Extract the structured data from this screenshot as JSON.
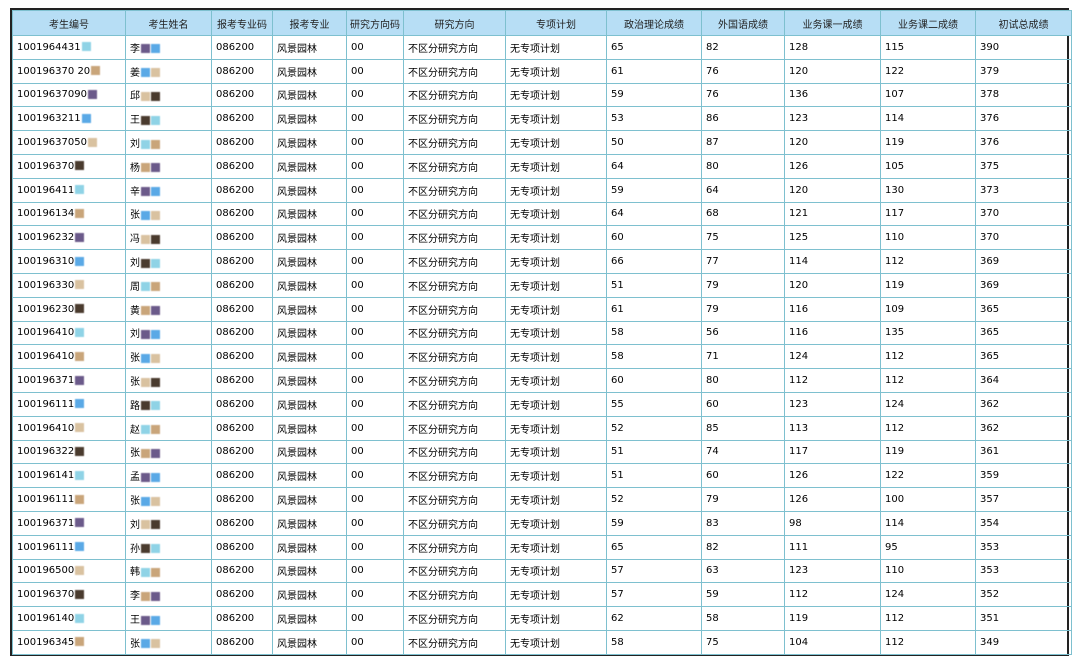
{
  "table": {
    "headers": [
      "考生编号",
      "考生姓名",
      "报考专业码",
      "报考专业",
      "研究方向码",
      "研究方向",
      "专项计划",
      "政治理论成绩",
      "外国语成绩",
      "业务课一成绩",
      "业务课二成绩",
      "初试总成绩"
    ],
    "rows": [
      [
        "1001964431",
        "李",
        "086200",
        "风景园林",
        "00",
        "不区分研究方向",
        "无专项计划",
        "65",
        "82",
        "128",
        "115",
        "390"
      ],
      [
        "100196370 20",
        "姜",
        "086200",
        "风景园林",
        "00",
        "不区分研究方向",
        "无专项计划",
        "61",
        "76",
        "120",
        "122",
        "379"
      ],
      [
        "10019637090",
        "邱",
        "086200",
        "风景园林",
        "00",
        "不区分研究方向",
        "无专项计划",
        "59",
        "76",
        "136",
        "107",
        "378"
      ],
      [
        "1001963211",
        "王",
        "086200",
        "风景园林",
        "00",
        "不区分研究方向",
        "无专项计划",
        "53",
        "86",
        "123",
        "114",
        "376"
      ],
      [
        "10019637050",
        "刘",
        "086200",
        "风景园林",
        "00",
        "不区分研究方向",
        "无专项计划",
        "50",
        "87",
        "120",
        "119",
        "376"
      ],
      [
        "100196370",
        "杨",
        "086200",
        "风景园林",
        "00",
        "不区分研究方向",
        "无专项计划",
        "64",
        "80",
        "126",
        "105",
        "375"
      ],
      [
        "100196411",
        "辛",
        "086200",
        "风景园林",
        "00",
        "不区分研究方向",
        "无专项计划",
        "59",
        "64",
        "120",
        "130",
        "373"
      ],
      [
        "100196134",
        "张",
        "086200",
        "风景园林",
        "00",
        "不区分研究方向",
        "无专项计划",
        "64",
        "68",
        "121",
        "117",
        "370"
      ],
      [
        "100196232",
        "冯",
        "086200",
        "风景园林",
        "00",
        "不区分研究方向",
        "无专项计划",
        "60",
        "75",
        "125",
        "110",
        "370"
      ],
      [
        "100196310",
        "刘",
        "086200",
        "风景园林",
        "00",
        "不区分研究方向",
        "无专项计划",
        "66",
        "77",
        "114",
        "112",
        "369"
      ],
      [
        "100196330",
        "周",
        "086200",
        "风景园林",
        "00",
        "不区分研究方向",
        "无专项计划",
        "51",
        "79",
        "120",
        "119",
        "369"
      ],
      [
        "100196230",
        "黄",
        "086200",
        "风景园林",
        "00",
        "不区分研究方向",
        "无专项计划",
        "61",
        "79",
        "116",
        "109",
        "365"
      ],
      [
        "100196410",
        "刘",
        "086200",
        "风景园林",
        "00",
        "不区分研究方向",
        "无专项计划",
        "58",
        "56",
        "116",
        "135",
        "365"
      ],
      [
        "100196410",
        "张",
        "086200",
        "风景园林",
        "00",
        "不区分研究方向",
        "无专项计划",
        "58",
        "71",
        "124",
        "112",
        "365"
      ],
      [
        "100196371",
        "张",
        "086200",
        "风景园林",
        "00",
        "不区分研究方向",
        "无专项计划",
        "60",
        "80",
        "112",
        "112",
        "364"
      ],
      [
        "100196111",
        "路",
        "086200",
        "风景园林",
        "00",
        "不区分研究方向",
        "无专项计划",
        "55",
        "60",
        "123",
        "124",
        "362"
      ],
      [
        "100196410",
        "赵",
        "086200",
        "风景园林",
        "00",
        "不区分研究方向",
        "无专项计划",
        "52",
        "85",
        "113",
        "112",
        "362"
      ],
      [
        "100196322",
        "张",
        "086200",
        "风景园林",
        "00",
        "不区分研究方向",
        "无专项计划",
        "51",
        "74",
        "117",
        "119",
        "361"
      ],
      [
        "100196141",
        "孟",
        "086200",
        "风景园林",
        "00",
        "不区分研究方向",
        "无专项计划",
        "51",
        "60",
        "126",
        "122",
        "359"
      ],
      [
        "100196111",
        "张",
        "086200",
        "风景园林",
        "00",
        "不区分研究方向",
        "无专项计划",
        "52",
        "79",
        "126",
        "100",
        "357"
      ],
      [
        "100196371",
        "刘",
        "086200",
        "风景园林",
        "00",
        "不区分研究方向",
        "无专项计划",
        "59",
        "83",
        "98",
        "114",
        "354"
      ],
      [
        "100196111",
        "孙",
        "086200",
        "风景园林",
        "00",
        "不区分研究方向",
        "无专项计划",
        "65",
        "82",
        "111",
        "95",
        "353"
      ],
      [
        "100196500",
        "韩",
        "086200",
        "风景园林",
        "00",
        "不区分研究方向",
        "无专项计划",
        "57",
        "63",
        "123",
        "110",
        "353"
      ],
      [
        "100196370",
        "李",
        "086200",
        "风景园林",
        "00",
        "不区分研究方向",
        "无专项计划",
        "57",
        "59",
        "112",
        "124",
        "352"
      ],
      [
        "100196140",
        "王",
        "086200",
        "风景园林",
        "00",
        "不区分研究方向",
        "无专项计划",
        "62",
        "58",
        "119",
        "112",
        "351"
      ],
      [
        "100196345",
        "张",
        "086200",
        "风景园林",
        "00",
        "不区分研究方向",
        "无专项计划",
        "58",
        "75",
        "104",
        "112",
        "349"
      ]
    ]
  },
  "colors": {
    "header_bg": "#b7def5",
    "grid_line": "#7ec0cf",
    "frame_border": "#222222",
    "mask_colors": [
      "#8fd3e6",
      "#c9a57a",
      "#6b5a8a",
      "#5aa9e6",
      "#d9c2a0",
      "#4a3b2e"
    ]
  }
}
